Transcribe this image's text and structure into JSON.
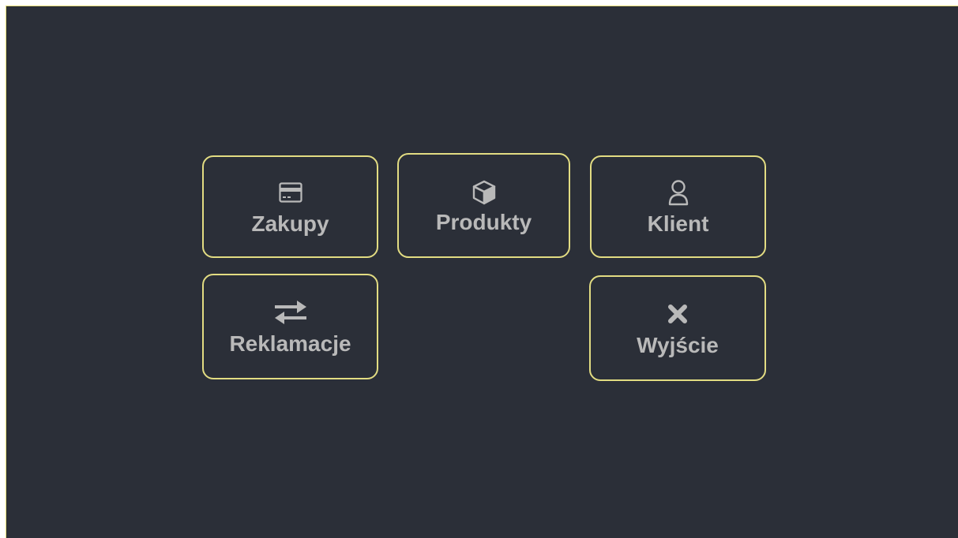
{
  "colors": {
    "background": "#2b2f38",
    "tile_border": "#e2dc82",
    "text": "#b9b9b9"
  },
  "menu": {
    "purchases": {
      "label": "Zakupy",
      "icon": "credit-card-icon"
    },
    "products": {
      "label": "Produkty",
      "icon": "box-icon"
    },
    "client": {
      "label": "Klient",
      "icon": "user-icon"
    },
    "complaints": {
      "label": "Reklamacje",
      "icon": "exchange-arrows-icon"
    },
    "exit": {
      "label": "Wyjście",
      "icon": "close-icon"
    }
  }
}
